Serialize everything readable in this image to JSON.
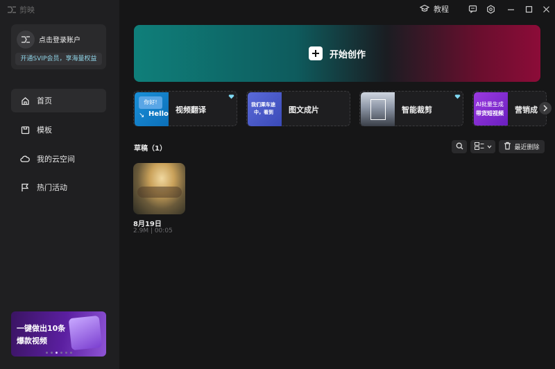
{
  "app": {
    "title": "剪映"
  },
  "account": {
    "login_text": "点击登录账户",
    "svip_text": "开通SVIP会员，享海量权益"
  },
  "nav": {
    "items": [
      {
        "label": "首页",
        "icon": "home-icon",
        "active": true
      },
      {
        "label": "模板",
        "icon": "template-icon",
        "active": false
      },
      {
        "label": "我的云空间",
        "icon": "cloud-icon",
        "active": false
      },
      {
        "label": "热门活动",
        "icon": "flag-icon",
        "active": false
      }
    ]
  },
  "promo": {
    "line1": "一键做出10条",
    "line2": "爆款视频"
  },
  "topbar": {
    "tutorial_label": "教程"
  },
  "hero": {
    "label": "开始创作"
  },
  "tools": [
    {
      "label": "视频翻译",
      "thumb_text_1": "你好!",
      "thumb_text_2": "Hello",
      "vip": true
    },
    {
      "label": "图文成片",
      "thumb_text_1": "我们乘车途",
      "thumb_text_2": "中，看到",
      "vip": false
    },
    {
      "label": "智能裁剪",
      "vip": true
    },
    {
      "label": "营销成",
      "thumb_text_1": "AI批量生成",
      "thumb_text_2": "带货短视频",
      "vip": false
    }
  ],
  "drafts": {
    "section_title": "草稿（1）",
    "delete_label": "最近删除",
    "items": [
      {
        "date": "8月19日",
        "meta": "2.9M | 00:05"
      }
    ]
  },
  "colors": {
    "accent_teal": "#0f7f7a",
    "accent_red": "#8c0c38",
    "vip_diamond": "#7fd8f2"
  }
}
